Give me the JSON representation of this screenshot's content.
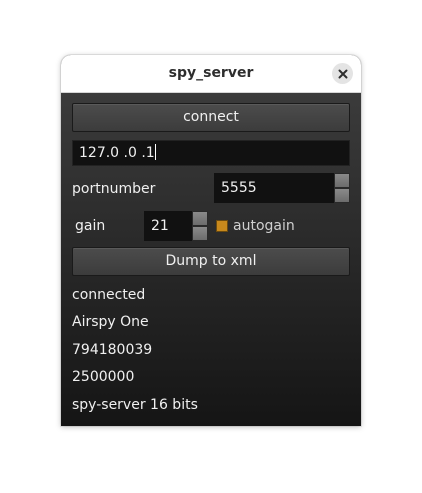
{
  "window": {
    "title": "spy_server"
  },
  "buttons": {
    "connect": "connect",
    "dump": "Dump to xml"
  },
  "ip_field": {
    "value": "127.0 .0 .1"
  },
  "port": {
    "label": "portnumber",
    "value": "5555"
  },
  "gain": {
    "label": "gain",
    "value": "21",
    "autogain_label": "autogain",
    "autogain_checked": true
  },
  "status": {
    "state": "connected",
    "device": "Airspy One",
    "serial": "794180039",
    "rate": "2500000",
    "format": "spy-server 16 bits"
  },
  "colors": {
    "checkbox": "#c8891c"
  },
  "icons": {
    "close": "close-icon"
  }
}
